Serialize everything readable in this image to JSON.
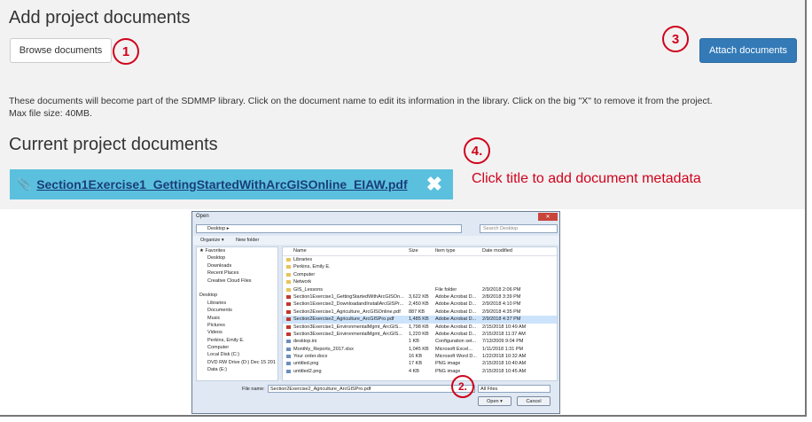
{
  "page": {
    "title": "Add project documents",
    "browse_label": "Browse documents",
    "attach_label": "Attach documents",
    "help_text": "These documents will become part of the SDMMP library. Click on the document name to edit its information in the library. Click on the big \"X\" to remove it from the project.",
    "max_size": "Max file size: 40MB.",
    "current_heading": "Current project documents",
    "document_name": "Section1Exercise1_GettingStartedWithArcGISOnline_EIAW.pdf",
    "remove_glyph": "✖",
    "clip_glyph": "📎"
  },
  "callouts": {
    "c1": "1",
    "c2": "2.",
    "c3": "3",
    "c4": "4."
  },
  "annotation": "Click title to add document metadata",
  "dialog": {
    "title": "Open",
    "close_glyph": "✕",
    "address": "Desktop ▸",
    "search_placeholder": "Search Desktop",
    "organize": "Organize ▾",
    "new_folder": "New folder",
    "nav_items": [
      "★ Favorites",
      "Desktop",
      "Downloads",
      "Recent Places",
      "Creative Cloud Files",
      "",
      "Desktop",
      "Libraries",
      "Documents",
      "Music",
      "Pictures",
      "Videos",
      "Perkins, Emily E.",
      "Computer",
      "Local Disk (C:)",
      "DVD RW Drive (D:) Dec 15 201",
      "Data (E:)"
    ],
    "columns": [
      "Name",
      "Size",
      "Item type",
      "Date modified"
    ],
    "rows": [
      {
        "name": "Libraries",
        "size": "",
        "type": "",
        "date": "",
        "sel": false
      },
      {
        "name": "Perkins, Emily E.",
        "size": "",
        "type": "",
        "date": "",
        "sel": false
      },
      {
        "name": "Computer",
        "size": "",
        "type": "",
        "date": "",
        "sel": false
      },
      {
        "name": "Network",
        "size": "",
        "type": "",
        "date": "",
        "sel": false
      },
      {
        "name": "GIS_Lessons",
        "size": "",
        "type": "File folder",
        "date": "2/9/2018 2:06 PM",
        "sel": false
      },
      {
        "name": "Section1Exercise1_GettingStartedWithArcGISOn...",
        "size": "3,622 KB",
        "type": "Adobe Acrobat D...",
        "date": "2/8/2018 3:39 PM",
        "sel": false
      },
      {
        "name": "Section1Exercise2_DownloadandInstallArcGISPr...",
        "size": "2,450 KB",
        "type": "Adobe Acrobat D...",
        "date": "2/9/2018 4:10 PM",
        "sel": false
      },
      {
        "name": "Section2Exercise1_Agriculture_ArcGISOnline.pdf",
        "size": "887 KB",
        "type": "Adobe Acrobat D...",
        "date": "2/9/2018 4:35 PM",
        "sel": false
      },
      {
        "name": "Section2Exercise2_Agriculture_ArcGISPro.pdf",
        "size": "1,485 KB",
        "type": "Adobe Acrobat D...",
        "date": "2/9/2018 4:37 PM",
        "sel": true
      },
      {
        "name": "Section3Exercise1_EnvironmentalMgmt_ArcGIS...",
        "size": "1,798 KB",
        "type": "Adobe Acrobat D...",
        "date": "2/15/2018 10:49 AM",
        "sel": false
      },
      {
        "name": "Section3Exercise2_EnvironmentalMgmt_ArcGIS...",
        "size": "1,220 KB",
        "type": "Adobe Acrobat D...",
        "date": "2/15/2018 11:37 AM",
        "sel": false
      },
      {
        "name": "desktop.ini",
        "size": "1 KB",
        "type": "Configuration set...",
        "date": "7/13/2009 9:04 PM",
        "sel": false
      },
      {
        "name": "Monthly_Reports_2017.xlsx",
        "size": "1,045 KB",
        "type": "Microsoft Excel...",
        "date": "1/11/2018 1:31 PM",
        "sel": false
      },
      {
        "name": "Your order.docx",
        "size": "16 KB",
        "type": "Microsoft Word D...",
        "date": "1/22/2018 10:32 AM",
        "sel": false
      },
      {
        "name": "untitled.png",
        "size": "17 KB",
        "type": "PNG image",
        "date": "2/15/2018 10:40 AM",
        "sel": false
      },
      {
        "name": "untitled2.png",
        "size": "4 KB",
        "type": "PNG image",
        "date": "2/15/2018 10:45 AM",
        "sel": false
      }
    ],
    "file_name_label": "File name:",
    "file_name_value": "Section2Exercise2_Agriculture_ArcGISPro.pdf",
    "file_type": "All Files",
    "open_label": "Open ▾",
    "cancel_label": "Cancel"
  },
  "colors": {
    "primary": "#337ab7",
    "info": "#5bc0de",
    "callout": "#d0021b",
    "panel": "#f2f2f2"
  }
}
